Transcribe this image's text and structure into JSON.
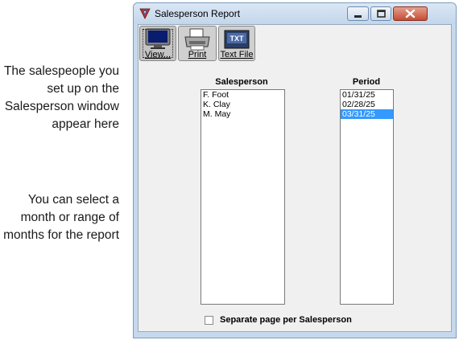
{
  "annotations": {
    "salespeople_note": "The salespeople you set up on the Salesperson window appear here",
    "period_note": "You can select a month or range of months for the report"
  },
  "window": {
    "title": "Salesperson Report"
  },
  "toolbar": {
    "view_label": "View...",
    "print_label": "Print",
    "textfile_label": "Text File",
    "textfile_icon_text": "TXT"
  },
  "salesperson": {
    "header": "Salesperson",
    "items": [
      "F. Foot",
      "K. Clay",
      "M. May"
    ]
  },
  "period": {
    "header": "Period",
    "items": [
      "01/31/25",
      "02/28/25",
      "03/31/25"
    ],
    "selected": "03/31/25"
  },
  "options": {
    "separate_page_label": "Separate page per Salesperson",
    "separate_page_checked": false
  },
  "colors": {
    "selection": "#3399ff",
    "close_button": "#c44d34"
  }
}
